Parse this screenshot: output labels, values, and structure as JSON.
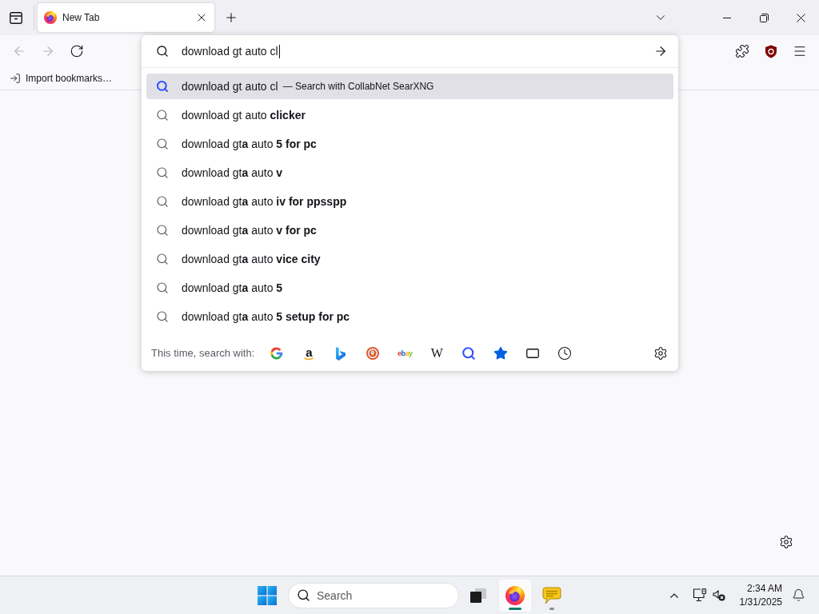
{
  "tab_strip": {
    "tabs": [
      {
        "title": "New Tab",
        "selected": true
      }
    ]
  },
  "toolbar": {
    "nav_buttons": [
      {
        "kind": "back",
        "disabled": true
      },
      {
        "kind": "forward",
        "disabled": true
      },
      {
        "kind": "reload",
        "disabled": false
      }
    ]
  },
  "bookmarks_bar": {
    "items": [
      {
        "label": "Import bookmarks…"
      }
    ]
  },
  "address_bar": {
    "value": "download gt auto cl"
  },
  "suggestions": [
    {
      "kind": "engine",
      "text": "download gt auto cl",
      "action": "— Search with CollabNet SearXNG",
      "selected": true
    },
    {
      "kind": "suggestion",
      "text": "download gt auto **clicker**",
      "selected": false
    },
    {
      "kind": "suggestion",
      "text": "download gt**a** auto **5 for pc**",
      "selected": false
    },
    {
      "kind": "suggestion",
      "text": "download gt**a** auto **v**",
      "selected": false
    },
    {
      "kind": "suggestion",
      "text": "download gt**a** auto **iv for ppsspp**",
      "selected": false
    },
    {
      "kind": "suggestion",
      "text": "download gt**a** auto **v for pc**",
      "selected": false
    },
    {
      "kind": "suggestion",
      "text": "download gt**a** auto **vice city**",
      "selected": false
    },
    {
      "kind": "suggestion",
      "text": "download gt**a** auto **5**",
      "selected": false
    },
    {
      "kind": "suggestion",
      "text": "download gt**a** auto **5 setup for pc**",
      "selected": false
    }
  ],
  "search_shortcuts": {
    "label": "This time, search with:",
    "engines": [
      {
        "kind": "google"
      },
      {
        "kind": "amazon",
        "glyph": "a"
      },
      {
        "kind": "bing"
      },
      {
        "kind": "duckduckgo"
      },
      {
        "kind": "ebay",
        "glyph": "ebay"
      },
      {
        "kind": "wikipedia",
        "glyph": "W"
      },
      {
        "kind": "searxng"
      },
      {
        "kind": "bookmarks"
      },
      {
        "kind": "tabs"
      },
      {
        "kind": "history"
      }
    ]
  },
  "taskbar": {
    "search": {
      "placeholder": "Search"
    },
    "apps": [
      {
        "kind": "task_view",
        "running": false,
        "focused": false
      },
      {
        "kind": "browser",
        "running": true,
        "focused": true
      },
      {
        "kind": "chat",
        "running": true,
        "focused": false
      }
    ],
    "clock": {
      "time": "2:34 AM",
      "date": "1/31/2025"
    }
  }
}
